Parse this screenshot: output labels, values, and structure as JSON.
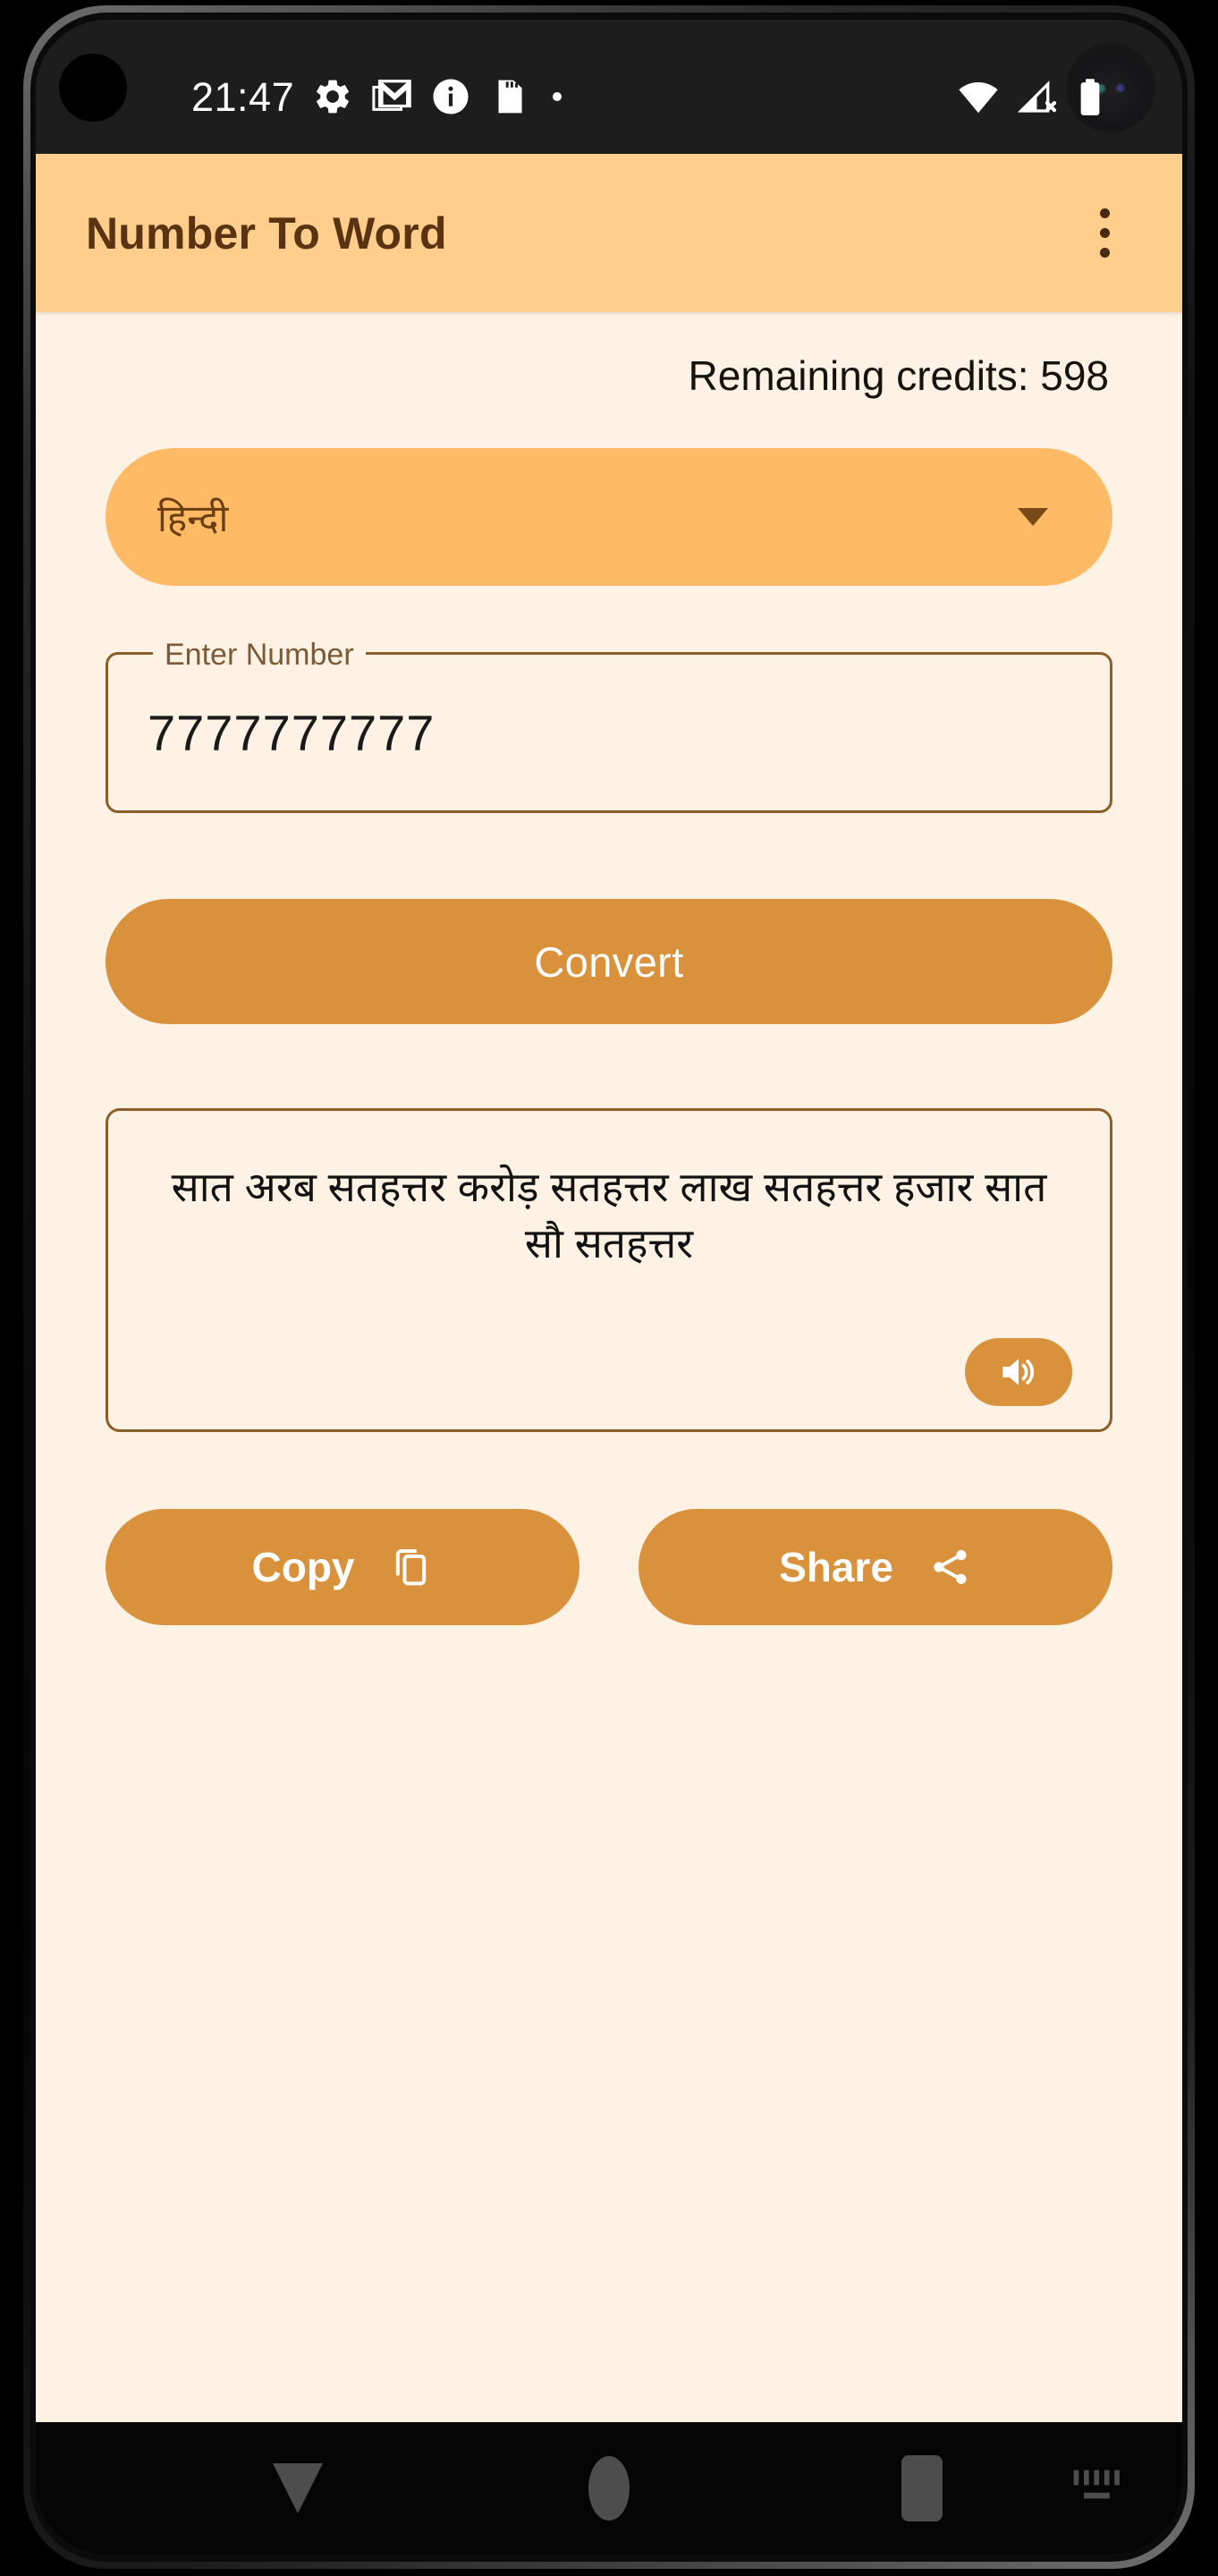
{
  "status_bar": {
    "clock": "21:47",
    "left_icons": [
      "gear-icon",
      "gmail-icon",
      "info-icon",
      "sd-card-icon",
      "dot-icon"
    ],
    "right_icons": [
      "wifi-icon",
      "cellular-no-sim-icon",
      "battery-icon"
    ]
  },
  "app_bar": {
    "title": "Number To Word",
    "overflow_menu": "overflow-menu-icon",
    "background": "#FFCD8C",
    "title_color": "#5A3312"
  },
  "main": {
    "credits": "Remaining credits: 598",
    "language_dropdown": {
      "selected": "हिन्दी",
      "caret": "chevron-down-icon",
      "background": "#FFBA66"
    },
    "number_field": {
      "label": "Enter Number",
      "value": "7777777777",
      "placeholder": ""
    },
    "convert_button": "Convert",
    "result": {
      "text": "सात अरब सतहत्तर करोड़ सतहत्तर लाख सतहत्तर हजार सात सौ सतहत्तर",
      "speak_icon": "volume-up-icon"
    },
    "copy_button": {
      "label": "Copy",
      "icon": "copy-icon"
    },
    "share_button": {
      "label": "Share",
      "icon": "share-icon"
    },
    "accent_color": "#D9913C",
    "background": "#FDF2E4"
  },
  "nav_bar": {
    "back": "back-triangle-icon",
    "home": "home-circle-icon",
    "recents": "recents-square-icon",
    "keyboard": "keyboard-switch-icon"
  }
}
